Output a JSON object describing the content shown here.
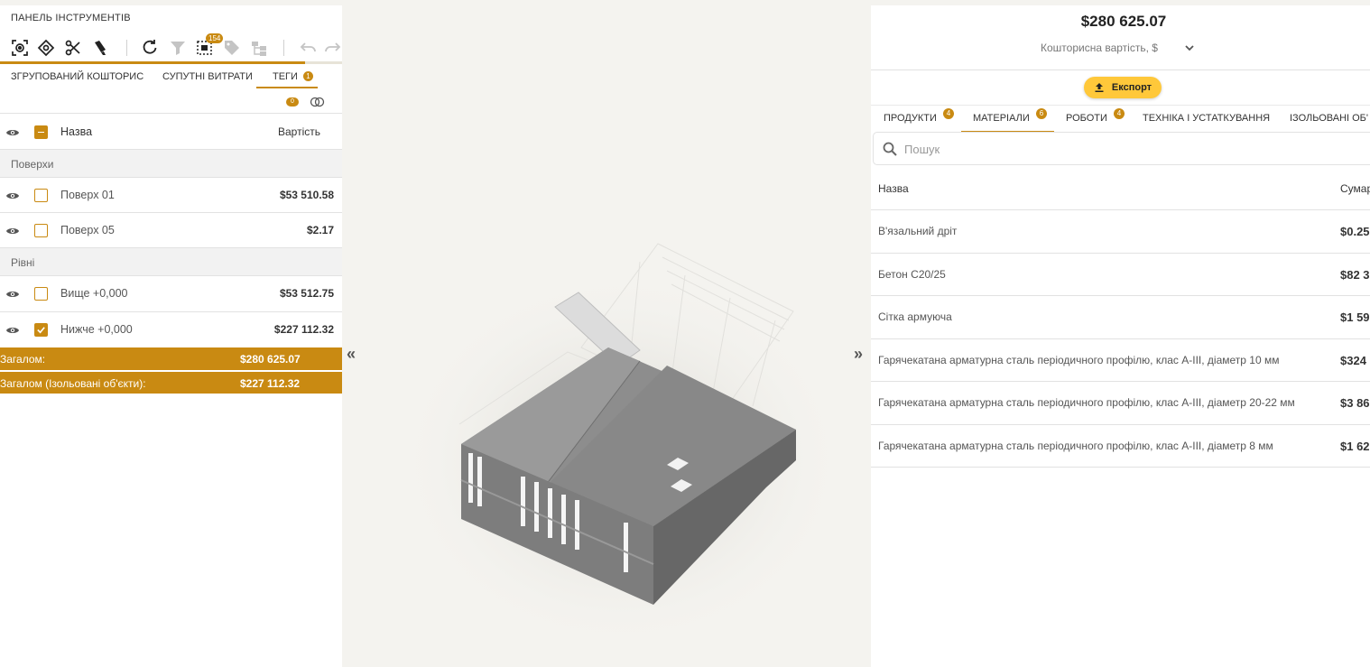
{
  "left_panel": {
    "title": "ПАНЕЛЬ ІНСТРУМЕНТІВ",
    "toolbar": {
      "selection_count": "154"
    },
    "tabs": [
      {
        "label": "ЗГРУПОВАНИЙ КОШТОРИС",
        "active": false
      },
      {
        "label": "СУПУТНІ ВИТРАТИ",
        "active": false
      },
      {
        "label": "ТЕГИ",
        "active": true,
        "badge": "1"
      }
    ],
    "filter_indicator": "0",
    "table_header": {
      "name": "Назва",
      "value": "Вартість"
    },
    "groups": [
      {
        "title": "Поверхи",
        "rows": [
          {
            "name": "Поверх 01",
            "value": "$53 510.58",
            "checked": false
          },
          {
            "name": "Поверх 05",
            "value": "$2.17",
            "checked": false
          }
        ]
      },
      {
        "title": "Рівні",
        "rows": [
          {
            "name": "Вище +0,000",
            "value": "$53 512.75",
            "checked": false
          },
          {
            "name": "Нижче +0,000",
            "value": "$227 112.32",
            "checked": true
          }
        ]
      }
    ],
    "totals": [
      {
        "label": "Загалом:",
        "value": "$280 625.07"
      },
      {
        "label": "Загалом (Ізольовані об'єкти):",
        "value": "$227 112.32"
      }
    ],
    "accent_color": "#c98a12"
  },
  "center": {
    "collapse_left": "«",
    "collapse_right": "»"
  },
  "right_panel": {
    "total": "$280 625.07",
    "cost_type": "Кошторисна вартість, $",
    "export_label": "Експорт",
    "tabs": [
      {
        "label": "ПРОДУКТИ",
        "badge": "4",
        "active": false
      },
      {
        "label": "МАТЕРІАЛИ",
        "badge": "6",
        "active": true
      },
      {
        "label": "РОБОТИ",
        "badge": "4",
        "active": false
      },
      {
        "label": "ТЕХНІКА І УСТАТКУВАННЯ",
        "active": false
      },
      {
        "label": "ІЗОЛЬОВАНІ ОБ'",
        "active": false
      }
    ],
    "search_placeholder": "Пошук",
    "table_header": {
      "name": "Назва",
      "sum": "Сумар"
    },
    "materials": [
      {
        "name": "В'язальний дріт",
        "sum": "$0.25"
      },
      {
        "name": "Бетон С20/25",
        "sum": "$82 3"
      },
      {
        "name": "Сітка армуюча",
        "sum": "$1 59"
      },
      {
        "name": "Гарячекатана арматурна сталь періодичного профілю, клас А-ІІІ, діаметр 10 мм",
        "sum": "$324"
      },
      {
        "name": "Гарячекатана арматурна сталь періодичного профілю, клас А-ІІІ, діаметр 20-22 мм",
        "sum": "$3 86"
      },
      {
        "name": "Гарячекатана арматурна сталь періодичного профілю, клас А-ІІІ, діаметр 8 мм",
        "sum": "$1 62"
      }
    ],
    "export_color": "#ffc83a"
  }
}
